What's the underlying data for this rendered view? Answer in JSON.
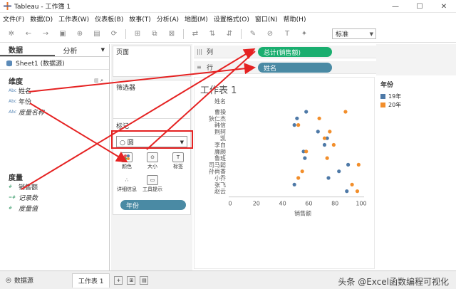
{
  "window": {
    "title": "Tableau - 工作簿 1"
  },
  "menu": [
    "文件(F)",
    "数据(D)",
    "工作表(W)",
    "仪表板(B)",
    "故事(T)",
    "分析(A)",
    "地图(M)",
    "设置格式(O)",
    "窗口(N)",
    "帮助(H)"
  ],
  "toolbar": {
    "fit_label": "标准"
  },
  "left": {
    "tabs": [
      "数据",
      "分析"
    ],
    "datasource": "Sheet1 (数据源)",
    "dimensions_label": "维度",
    "dimensions": [
      "姓名",
      "年份",
      "度量名称"
    ],
    "measures_label": "度量",
    "measures": [
      "销售额",
      "记录数",
      "度量值"
    ]
  },
  "cards": {
    "pages": "页面",
    "filters": "筛选器",
    "marks": "标记",
    "mark_type": "○ 圆",
    "mark_buttons": [
      "颜色",
      "大小",
      "标签",
      "详细信息",
      "工具提示"
    ],
    "color_pill": "年份"
  },
  "shelves": {
    "columns_label": "列",
    "columns_pill": "总计(销售额)",
    "rows_label": "行",
    "rows_pill": "姓名"
  },
  "legend": {
    "title": "年份",
    "items": [
      "19年",
      "20年"
    ],
    "colors": [
      "#4e79a7",
      "#f28e2b"
    ]
  },
  "status": {
    "datasource_tab": "数据源",
    "sheet_tab": "工作表 1"
  },
  "watermark": "头条 @Excel函数编程可视化",
  "chart_data": {
    "type": "scatter",
    "title": "工作表 1",
    "xlabel": "销售额",
    "ylabel": "姓名",
    "xlim": [
      0,
      100
    ],
    "xticks": [
      0,
      20,
      40,
      60,
      80,
      100
    ],
    "categories": [
      "曹操",
      "狄仁杰",
      "韩信",
      "荆轲",
      "凯",
      "李白",
      "廉颇",
      "鲁班",
      "司马懿",
      "孙尚香",
      "小乔",
      "张飞",
      "赵云"
    ],
    "series": [
      {
        "name": "19年",
        "values": [
          58,
          51,
          49,
          67,
          74,
          72,
          56,
          57,
          90,
          83,
          75,
          49,
          89
        ]
      },
      {
        "name": "20年",
        "values": [
          88,
          68,
          52,
          76,
          72,
          79,
          58,
          74,
          98,
          55,
          52,
          93,
          97
        ]
      }
    ]
  }
}
